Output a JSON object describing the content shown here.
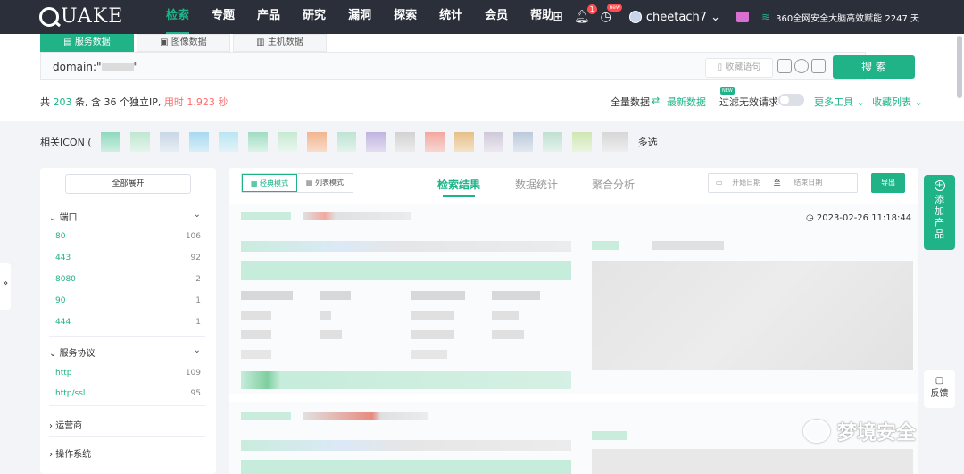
{
  "nav": {
    "logo": "UAKE",
    "items": [
      "检索",
      "专题",
      "产品",
      "研究",
      "漏洞",
      "探索",
      "统计",
      "会员",
      "帮助"
    ],
    "notif_count": "1",
    "new_badge": "new",
    "username": "cheetach7",
    "slogan": "360全网安全大脑高效赋能 2247 天"
  },
  "search": {
    "tabs": [
      "服务数据",
      "图像数据",
      "主机数据"
    ],
    "query_prefix": "domain:\"",
    "query_suffix": "\"",
    "fav_label": "收藏语句",
    "search_label": "搜 索"
  },
  "stats": {
    "prefix": "共 ",
    "count": "203",
    "mid": " 条, 含 36 个独立IP, ",
    "time": "用时 1.923 秒"
  },
  "tools": {
    "full_data": "全量数据",
    "latest_data": "最新数据",
    "filter_invalid": "过滤无效请求",
    "new_tag": "NEW",
    "more_tools": "更多工具",
    "favorites": "收藏列表"
  },
  "icon_row": {
    "label": "相关ICON (",
    "multi": "多选"
  },
  "sidebar": {
    "expand_all": "全部展开",
    "groups": [
      {
        "title": "端口",
        "items": [
          {
            "label": "80",
            "count": "106"
          },
          {
            "label": "443",
            "count": "92"
          },
          {
            "label": "8080",
            "count": "2"
          },
          {
            "label": "90",
            "count": "1"
          },
          {
            "label": "444",
            "count": "1"
          }
        ]
      },
      {
        "title": "服务协议",
        "items": [
          {
            "label": "http",
            "count": "109"
          },
          {
            "label": "http/ssl",
            "count": "95"
          }
        ]
      },
      {
        "title": "运营商",
        "items": []
      },
      {
        "title": "操作系统",
        "items": []
      }
    ]
  },
  "results": {
    "modes": [
      "经典模式",
      "列表模式"
    ],
    "tabs": [
      "检索结果",
      "数据统计",
      "聚合分析"
    ],
    "date_start": "开始日期",
    "date_sep": "至",
    "date_end": "结束日期",
    "export": "导出",
    "timestamp": "2023-02-26 11:18:44"
  },
  "floating": {
    "add_product": "添加产品",
    "feedback": "反馈"
  },
  "watermark": "梦境安全",
  "colors": {
    "accent": "#1fb387",
    "nav_bg": "#2b2f3a",
    "danger": "#ff6b6b"
  }
}
